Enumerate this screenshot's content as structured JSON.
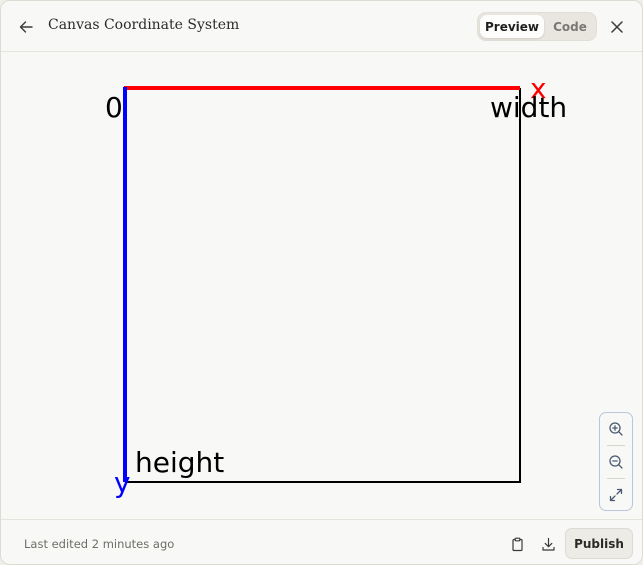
{
  "header": {
    "title": "Canvas Coordinate System",
    "toggle": {
      "preview_label": "Preview",
      "code_label": "Code",
      "selected": "Preview"
    },
    "icons": {
      "back": "arrow-left-icon",
      "close": "close-icon"
    }
  },
  "canvas": {
    "origin_label": "0",
    "x_axis_label": "x",
    "width_label": "width",
    "y_axis_label": "y",
    "height_label": "height",
    "colors": {
      "x_axis": "#ff0000",
      "y_axis": "#0000ff",
      "box": "#000000"
    }
  },
  "zoom": {
    "icons": {
      "zoom_in": "zoom-in-icon",
      "zoom_out": "zoom-out-icon",
      "fit": "expand-icon"
    }
  },
  "footer": {
    "last_edited": "Last edited 2 minutes ago",
    "publish_label": "Publish",
    "icons": {
      "copy": "clipboard-icon",
      "download": "download-icon"
    }
  }
}
